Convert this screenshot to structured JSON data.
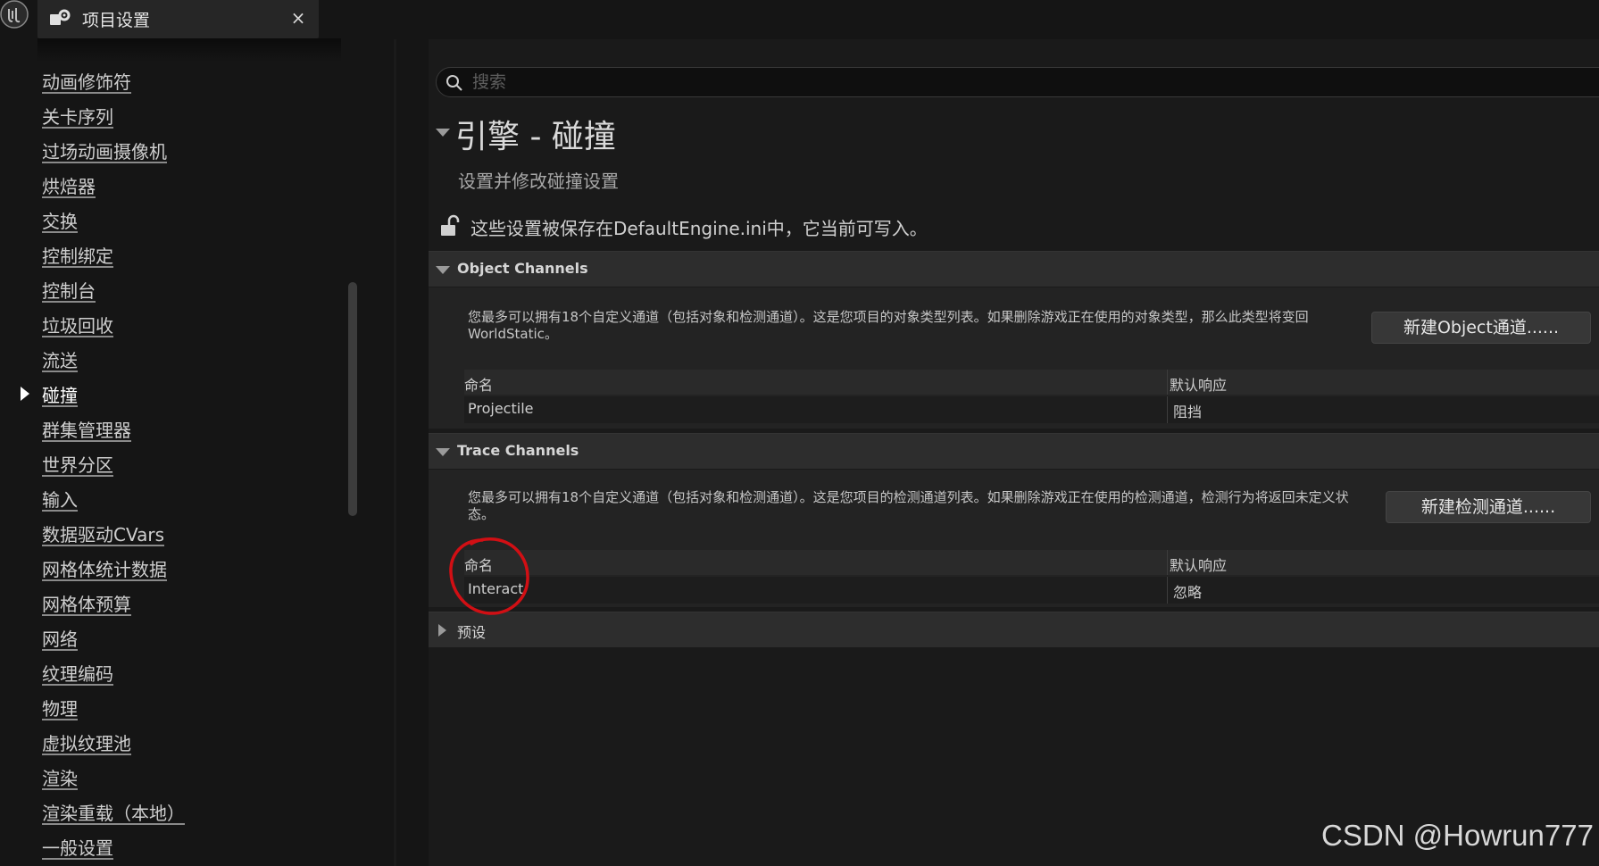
{
  "tab": {
    "title": "项目设置",
    "close": "×"
  },
  "sidebar": {
    "selected_index": 9,
    "items": [
      {
        "label": "动画修饰符"
      },
      {
        "label": "关卡序列"
      },
      {
        "label": "过场动画摄像机"
      },
      {
        "label": "烘焙器"
      },
      {
        "label": "交换"
      },
      {
        "label": "控制绑定"
      },
      {
        "label": "控制台"
      },
      {
        "label": "垃圾回收"
      },
      {
        "label": "流送"
      },
      {
        "label": "碰撞"
      },
      {
        "label": "群集管理器"
      },
      {
        "label": "世界分区"
      },
      {
        "label": "输入"
      },
      {
        "label": "数据驱动CVars"
      },
      {
        "label": "网格体统计数据"
      },
      {
        "label": "网格体预算"
      },
      {
        "label": "网络"
      },
      {
        "label": "纹理编码"
      },
      {
        "label": "物理"
      },
      {
        "label": "虚拟纹理池"
      },
      {
        "label": "渲染"
      },
      {
        "label": "渲染重载（本地）"
      },
      {
        "label": "一般设置"
      }
    ]
  },
  "search": {
    "placeholder": "搜索"
  },
  "page": {
    "title": "引擎 - 碰撞",
    "subtitle": "设置并修改碰撞设置",
    "save_note": "这些设置被保存在DefaultEngine.ini中，它当前可写入。"
  },
  "object_channels": {
    "title": "Object Channels",
    "description": "您最多可以拥有18个自定义通道（包括对象和检测通道）。这是您项目的对象类型列表。如果删除游戏正在使用的对象类型，那么此类型将变回WorldStatic。",
    "button": "新建Object通道......",
    "columns": [
      "命名",
      "默认响应"
    ],
    "rows": [
      {
        "name": "Projectile",
        "response": "阻挡"
      }
    ]
  },
  "trace_channels": {
    "title": "Trace Channels",
    "description": "您最多可以拥有18个自定义通道（包括对象和检测通道）。这是您项目的检测通道列表。如果删除游戏正在使用的检测通道，检测行为将返回未定义状态。",
    "button": "新建检测通道......",
    "columns": [
      "命名",
      "默认响应"
    ],
    "rows": [
      {
        "name": "Interact",
        "response": "忽略"
      }
    ]
  },
  "presets": {
    "title": "预设"
  },
  "watermark": "CSDN @Howrun777",
  "colors": {
    "background": "#151515",
    "panel": "#232323",
    "category_bar": "#2d2d2d",
    "annotation": "#d10f14"
  }
}
